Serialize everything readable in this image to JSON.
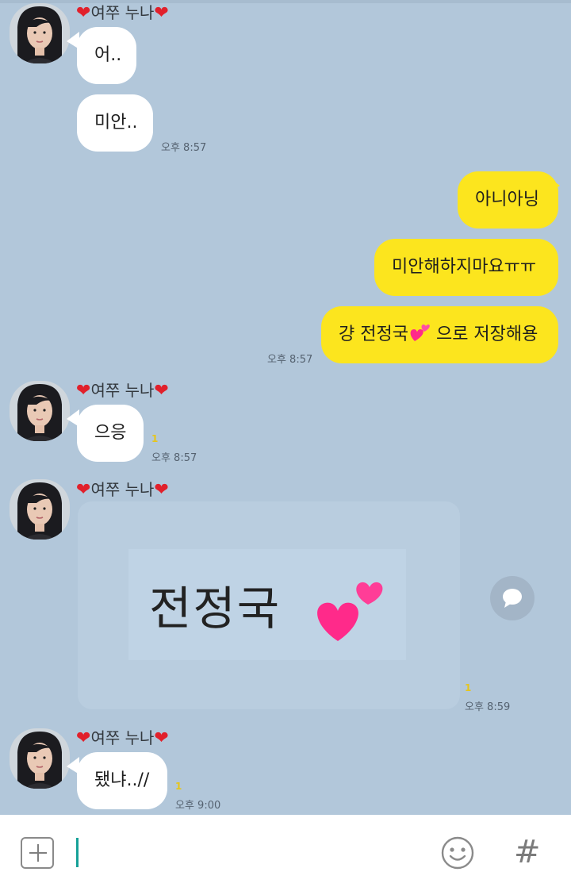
{
  "sender_name_left_heart": "❤",
  "sender_name_text": "여쭈 누나",
  "sender_name_right_heart": "❤",
  "messages": [
    {
      "text": "어.."
    },
    {
      "text": "미안.."
    },
    {
      "text": "아니아닝"
    },
    {
      "text": "미안해하지마요ㅠㅠ"
    },
    {
      "text_before": "걍 전정국",
      "text_after": " 으로 저장해용"
    },
    {
      "text": "으응"
    },
    {
      "photo_word": "전정국"
    },
    {
      "text": "됐냐..//"
    }
  ],
  "times": {
    "t1": "오후 8:57",
    "t2": "오후 8:57",
    "t3": "오후 8:57",
    "t4": "오후 8:59",
    "t5": "오후 9:00"
  },
  "unread_count": "1",
  "input": {
    "placeholder": "",
    "plus_icon": "plus-square-icon",
    "emoji_icon": "smiley-icon",
    "hash_label": "#"
  },
  "colors": {
    "background": "#b2c7da",
    "my_bubble": "#fce51e",
    "their_bubble": "#ffffff",
    "heart": "#e1202b",
    "caret": "#16a198"
  }
}
